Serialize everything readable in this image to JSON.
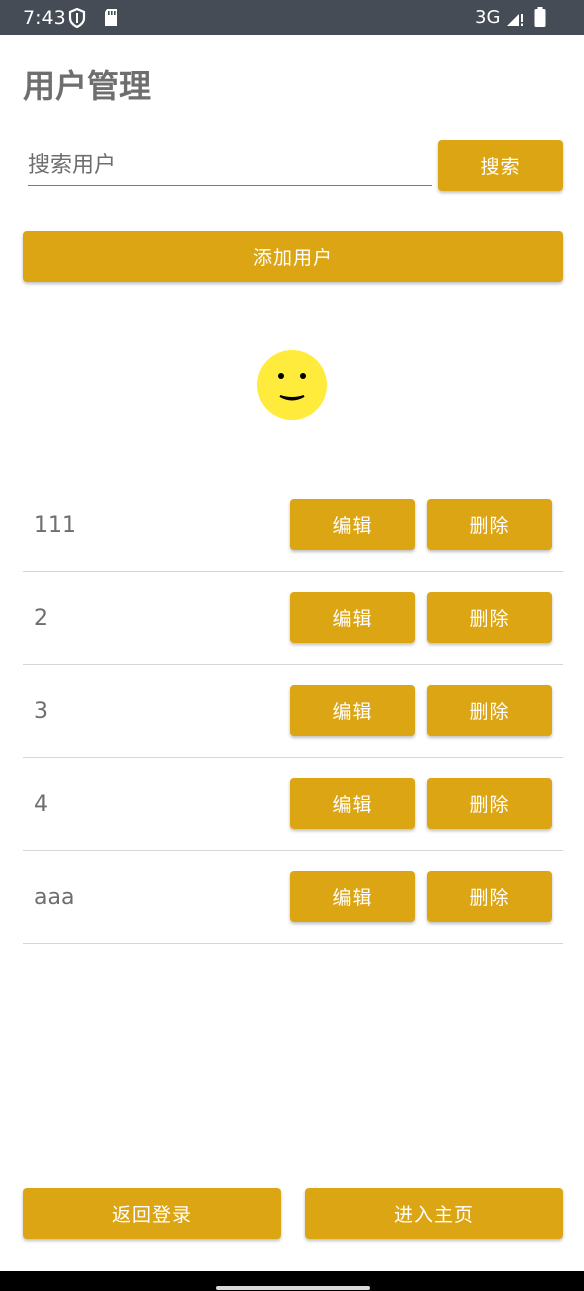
{
  "status_bar": {
    "time": "7:43",
    "network": "3G",
    "icons": [
      "shield-icon",
      "sd-card-icon",
      "signal-icon",
      "battery-icon"
    ]
  },
  "page": {
    "title": "用户管理"
  },
  "search": {
    "value": "",
    "placeholder": "搜索用户",
    "button_label": "搜索"
  },
  "actions": {
    "add_user_label": "添加用户"
  },
  "avatar": {
    "icon": "smiley-face-icon",
    "color": "#ffeb3b"
  },
  "users": [
    {
      "name": "111",
      "edit_label": "编辑",
      "delete_label": "删除"
    },
    {
      "name": "2",
      "edit_label": "编辑",
      "delete_label": "删除"
    },
    {
      "name": "3",
      "edit_label": "编辑",
      "delete_label": "删除"
    },
    {
      "name": "4",
      "edit_label": "编辑",
      "delete_label": "删除"
    },
    {
      "name": "aaa",
      "edit_label": "编辑",
      "delete_label": "删除"
    }
  ],
  "footer": {
    "back_login_label": "返回登录",
    "enter_home_label": "进入主页"
  },
  "colors": {
    "accent": "#dca513",
    "status_bar": "#454c55",
    "title_text": "#6e6e6e",
    "divider": "#d6d6d6"
  }
}
